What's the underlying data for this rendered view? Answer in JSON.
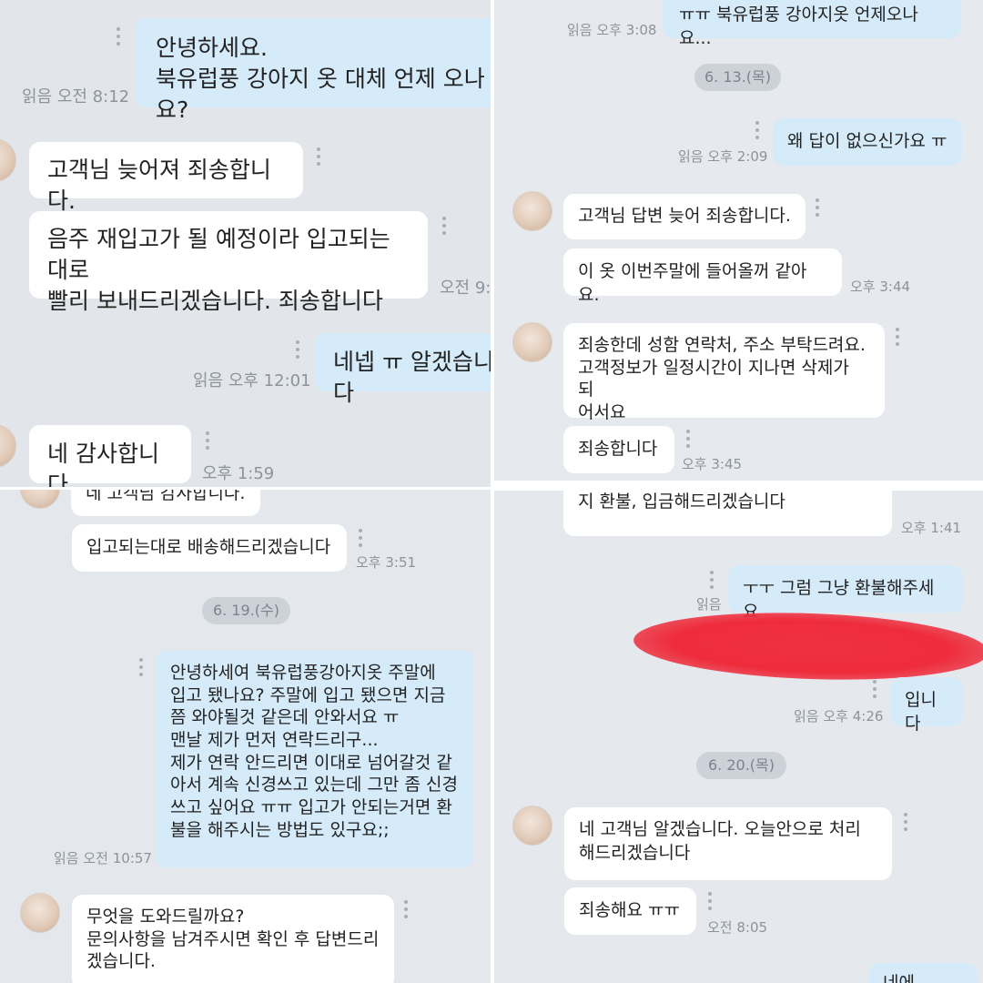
{
  "top_left": {
    "msg1": "안녕하세요.\n북유럽풍 강아지 옷 대체 언제 오나요?",
    "msg1_meta": "읽음 오전 8:12",
    "msg2": "고객님 늦어져 죄송합니다.",
    "msg3": "음주 재입고가 될 예정이라 입고되는대로\n빨리 보내드리겠습니다. 죄송합니다",
    "msg3_meta": "오전 9:",
    "msg4": "네넵 ㅠ 알겠습니다",
    "msg4_meta": "읽음 오후 12:01",
    "msg5": "네 감사합니다",
    "msg5_meta": "오후 1:59"
  },
  "top_right": {
    "msg1": "ㅠㅠ 북유럽풍 강아지옷 언제오나요...",
    "msg1_meta": "읽음 오후 3:08",
    "date1": "6. 13.(목)",
    "msg2": "왜 답이 없으신가요 ㅠ",
    "msg2_meta": "읽음 오후 2:09",
    "msg3": "고객님 답변 늦어 죄송합니다.",
    "msg4": "이 옷 이번주말에 들어올꺼 같아요.",
    "msg4_meta": "오후 3:44",
    "msg5": "죄송한데 성함 연락처, 주소 부탁드려요.\n고객정보가 일정시간이 지나면 삭제가 되\n어서요",
    "msg6": "죄송합니다",
    "msg6_meta": "오후 3:45"
  },
  "bottom_left": {
    "msg0": "네 고객님 감사합니다.",
    "msg1": "입고되는대로 배송해드리겠습니다",
    "msg1_meta": "오후 3:51",
    "date1": "6. 19.(수)",
    "msg2": "안녕하세여 북유럽풍강아지옷 주말에\n입고 됐나요? 주말에 입고 됐으면 지금\n쯤 와야될것 같은데 안와서요 ㅠ\n맨날 제가 먼저 연락드리구...\n제가 연락 안드리면 이대로 넘어갈것 같\n아서 계속 신경쓰고 있는데 그만 좀 신경\n쓰고 싶어요 ㅠㅠ 입고가 안되는거면 환\n불을 해주시는 방법도 있구요;;",
    "msg2_meta": "읽음 오전 10:57",
    "msg3": "무엇을 도와드릴까요?\n문의사항을 남겨주시면 확인 후 답변드리\n겠습니다."
  },
  "bottom_right": {
    "msg0": "지 환불, 입금해드리겠습니다",
    "msg0_meta": "오후 1:41",
    "msg1": "ㅜㅜ 그럼 그냥 환불해주세요",
    "msg1_meta": "읽음",
    "msg2": "입니다",
    "msg2_meta": "읽음 오후 4:26",
    "date1": "6. 20.(목)",
    "msg3": "네 고객님 알겠습니다. 오늘안으로 처리\n해드리겠습니다",
    "msg4": "죄송해요 ㅠㅠ",
    "msg4_meta": "오전 8:05",
    "msg5": "네에"
  }
}
